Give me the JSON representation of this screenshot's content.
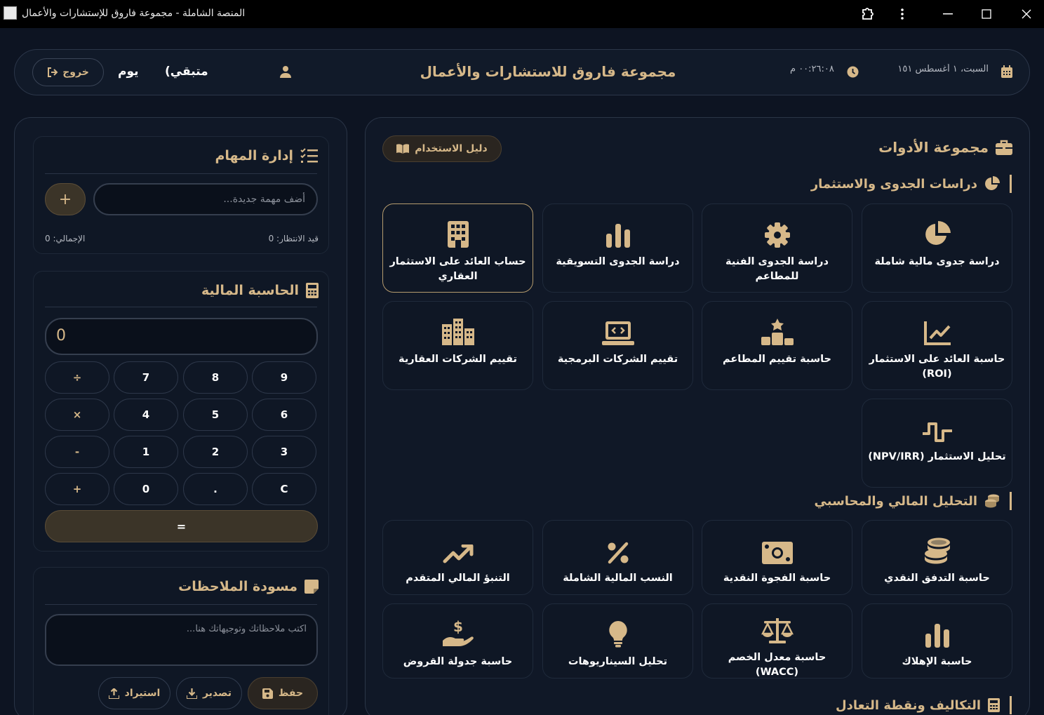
{
  "window": {
    "title": "المنصة الشاملة - مجموعة فاروق للإستشارات والأعمال"
  },
  "header": {
    "logout_label": "خروج",
    "day_label": "يوم",
    "remaining_label": "(متبقي",
    "brand": "مجموعة فاروق للاستشارات والأعمال",
    "date_text": "السبت، ١ أغسطس ١٥١",
    "time_text": "٠٠:٢٦:٠٨ م"
  },
  "tasks": {
    "title": "إدارة المهام",
    "input_placeholder": "أضف مهمة جديدة...",
    "add_label": "+",
    "pending_label": "قيد الانتظار: 0",
    "total_label": "الإجمالي: 0"
  },
  "calculator": {
    "title": "الحاسبة المالية",
    "display": "0",
    "rows": [
      [
        "9",
        "8",
        "7",
        "÷"
      ],
      [
        "6",
        "5",
        "4",
        "×"
      ],
      [
        "3",
        "2",
        "1",
        "-"
      ],
      [
        "C",
        ".",
        "0",
        "+"
      ]
    ],
    "equals": "="
  },
  "notes": {
    "title": "مسودة الملاحظات",
    "placeholder": "اكتب ملاحظاتك وتوجيهاتك هنا...",
    "save_label": "حفظ",
    "export_label": "تصدير",
    "import_label": "استيراد"
  },
  "tools": {
    "title": "مجموعة الأدوات",
    "guide_label": "دليل الاستخدام",
    "sections": [
      {
        "title": "دراسات الجدوى والاستثمار",
        "items": [
          {
            "label": "دراسة جدوى مالية شاملة",
            "icon": "pie-chart-icon"
          },
          {
            "label": "دراسة الجدوى الفنية للمطاعم",
            "icon": "gear-icon"
          },
          {
            "label": "دراسة الجدوى التسويقية",
            "icon": "bar-chart-icon"
          },
          {
            "label": "حساب العائد على الاستثمار العقاري",
            "icon": "building-icon"
          },
          {
            "label": "حاسبة العائد على الاستثمار (ROI)",
            "icon": "line-chart-icon"
          },
          {
            "label": "حاسبة تقييم المطاعم",
            "icon": "ranking-icon"
          },
          {
            "label": "تقييم الشركات البرمجية",
            "icon": "laptop-code-icon"
          },
          {
            "label": "تقييم الشركات العقارية",
            "icon": "city-icon"
          },
          {
            "label": "تحليل الاستثمار (NPV/IRR)",
            "icon": "wave-icon"
          }
        ]
      },
      {
        "title": "التحليل المالي والمحاسبي",
        "items": [
          {
            "label": "حاسبة التدفق النقدي",
            "icon": "coins-icon"
          },
          {
            "label": "حاسبة الفجوة النقدية",
            "icon": "money-bill-icon"
          },
          {
            "label": "النسب المالية الشاملة",
            "icon": "percent-icon"
          },
          {
            "label": "التنبؤ المالي المتقدم",
            "icon": "trend-up-icon"
          },
          {
            "label": "حاسبة الإهلاك",
            "icon": "bar-chart-icon"
          },
          {
            "label": "حاسبة معدل الخصم (WACC)",
            "icon": "scale-icon"
          },
          {
            "label": "تحليل السيناريوهات",
            "icon": "lightbulb-icon"
          },
          {
            "label": "حاسبة جدولة القروض",
            "icon": "hand-dollar-icon"
          }
        ]
      },
      {
        "title": "التكاليف ونقطة التعادل"
      }
    ]
  },
  "colors": {
    "accent": "#d6b889",
    "background": "#0d1422",
    "panel": "#101827"
  }
}
